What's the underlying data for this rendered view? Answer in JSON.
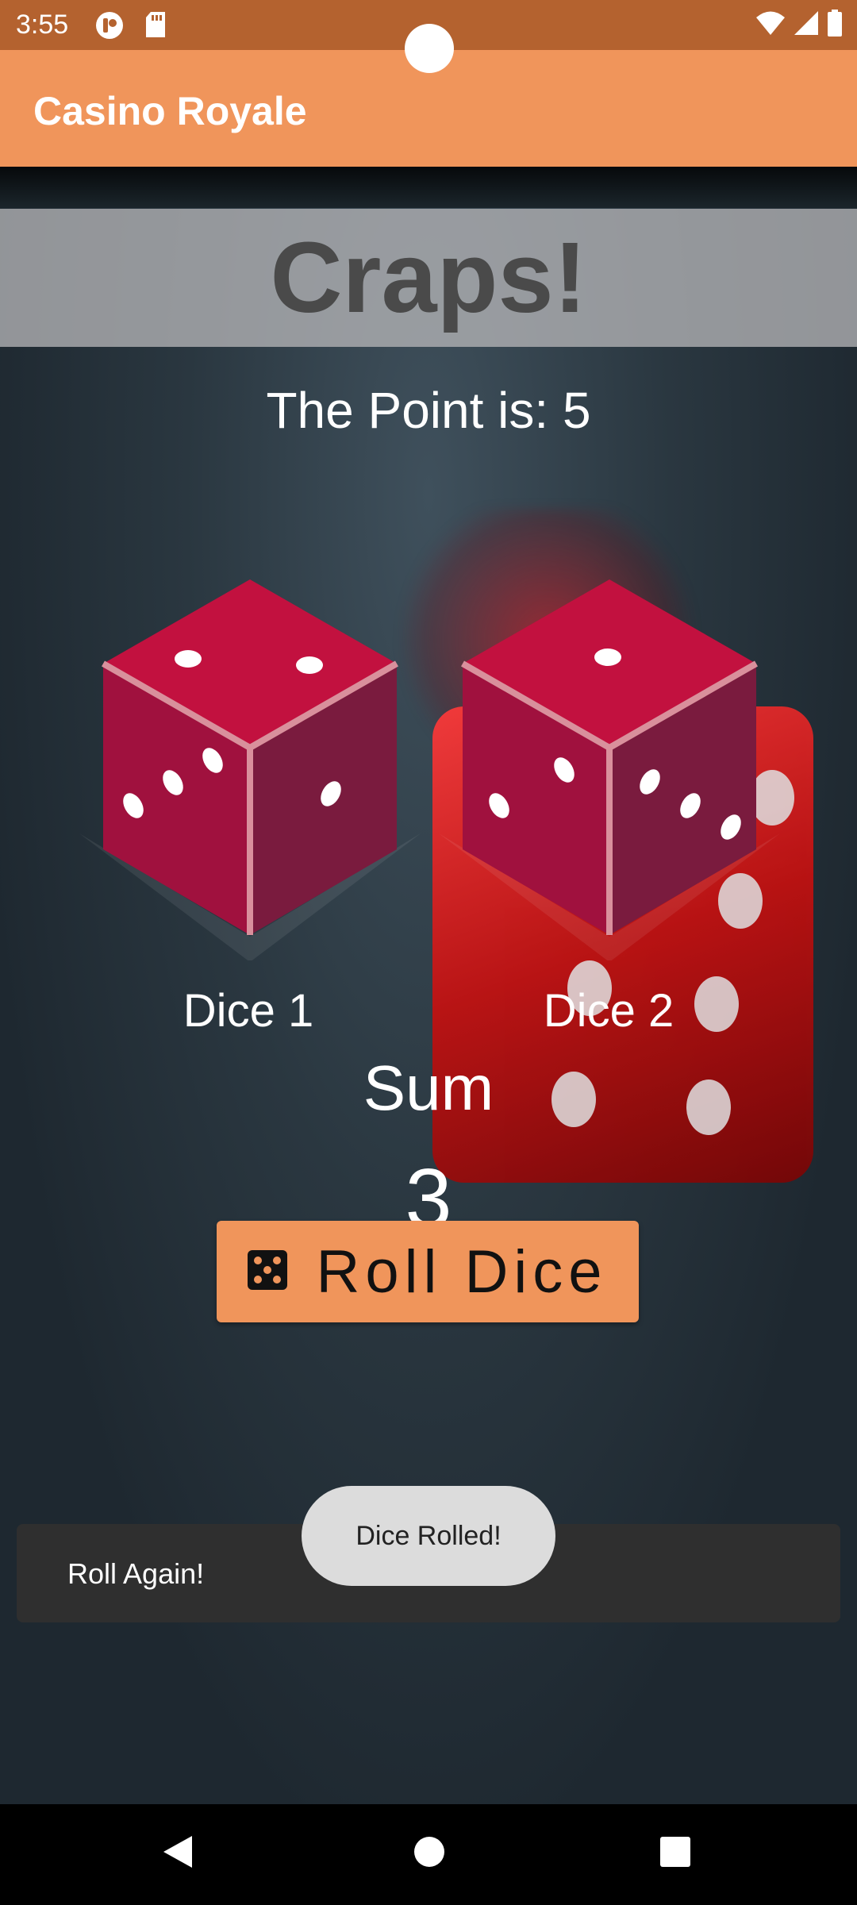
{
  "status_bar": {
    "time": "3:55",
    "icons": [
      "notification-app-icon",
      "sd-card-icon",
      "wifi-icon",
      "signal-icon",
      "battery-icon"
    ]
  },
  "app_bar": {
    "title": "Casino Royale"
  },
  "screen": {
    "title": "Craps!",
    "point_text": "The Point is: 5",
    "dice": [
      {
        "label": "Dice 1",
        "value": 3
      },
      {
        "label": "Dice 2",
        "value": 3
      }
    ],
    "sum_label": "Sum",
    "sum_value": "3"
  },
  "roll_button": {
    "label": "Roll Dice",
    "icon": "dice-five-icon"
  },
  "snackbar": {
    "text": "Roll Again!"
  },
  "toast": {
    "text": "Dice Rolled!"
  },
  "nav": {
    "buttons": [
      "back-icon",
      "home-icon",
      "recents-icon"
    ]
  },
  "colors": {
    "status_bar": "#B4622F",
    "app_bar": "#F0955B",
    "button": "#F0955B",
    "die_top": "#C2113F",
    "die_left": "#A0113E",
    "die_right": "#7A1B3E"
  }
}
